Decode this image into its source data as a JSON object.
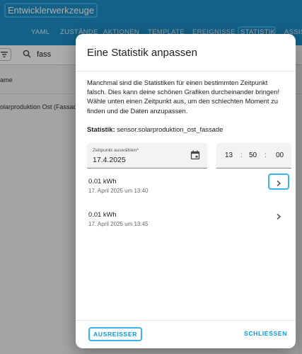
{
  "page": {
    "title": "Entwicklerwerkzeuge",
    "tabs": [
      "YAML",
      "ZUSTÄNDE",
      "AKTIONEN",
      "TEMPLATE",
      "EREIGNISSE",
      "STATISTIK",
      "ASSIS"
    ],
    "active_tab": "STATISTIK",
    "search_value": "fass",
    "column_header": "ame",
    "row_name": "olarproduktion Ost (Fassade)"
  },
  "dialog": {
    "title": "Eine Statistik anpassen",
    "description": "Manchmal sind die Statistiken für einen bestimmten Zeitpunkt falsch. Dies kann deine schönen Grafiken durcheinander bringen! Wähle unten einen Zeitpunkt aus, um den schlechten Moment zu finden und die Daten anzupassen.",
    "statistic_label": "Statistik:",
    "statistic_value": "sensor.solarproduktion_ost_fassade",
    "date_label": "Zeitpunkt auswählen*",
    "date_value": "17.4.2025",
    "time": {
      "hours": "13",
      "minutes": "50",
      "seconds": "00",
      "separator": ":"
    },
    "entries": [
      {
        "value": "0.01 kWh",
        "time": "17. April 2025 um 13:40"
      },
      {
        "value": "0.01 kWh",
        "time": "17. April 2025 um 13:45"
      }
    ],
    "buttons": {
      "outlier": "AUSREISSER",
      "close": "SCHLIESSEN"
    }
  },
  "colors": {
    "header": "#1e8fc9",
    "accent": "#039be5",
    "highlight": "#39b4ec"
  }
}
